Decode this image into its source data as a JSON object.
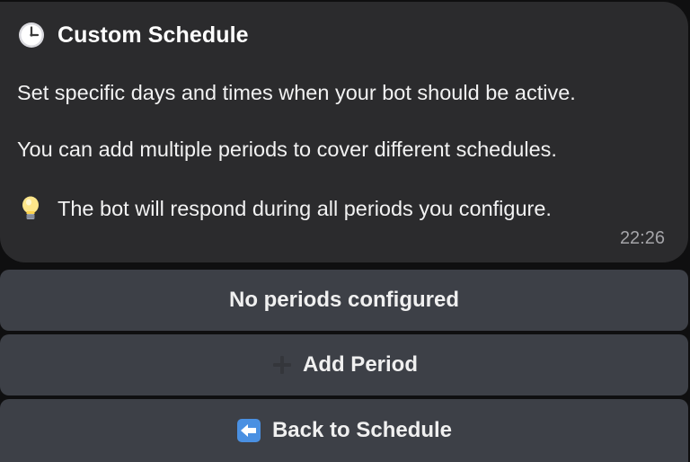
{
  "message": {
    "title_icon": "clock-icon",
    "title": "Custom Schedule",
    "line1": "Set specific days and times when your bot should be active.",
    "line2": "You can add multiple periods to cover different schedules.",
    "line3_icon": "lightbulb-icon",
    "line3": "The bot will respond during all periods you configure.",
    "time": "22:26"
  },
  "buttons": {
    "no_periods": "No periods configured",
    "add_period_icon": "plus-icon",
    "add_period": "Add Period",
    "back_icon": "left-arrow-icon",
    "back": "Back to Schedule"
  },
  "colors": {
    "bubble_bg": "#2b2b2d",
    "button_bg": "#3d4047",
    "timestamp": "#a4a4a8"
  }
}
